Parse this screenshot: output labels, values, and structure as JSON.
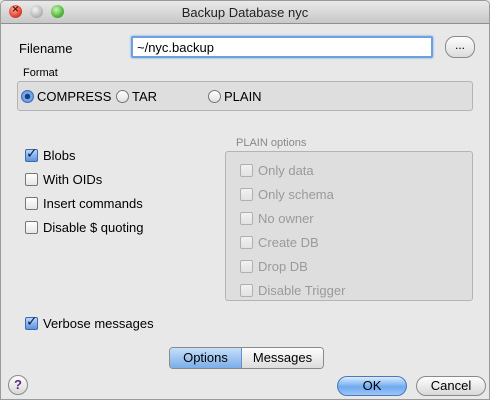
{
  "window": {
    "title": "Backup Database nyc",
    "close_glyph": "×"
  },
  "filename": {
    "label": "Filename",
    "value": "~/nyc.backup",
    "browse_label": "..."
  },
  "format": {
    "caption": "Format",
    "options": [
      {
        "label": "COMPRESS",
        "checked": true
      },
      {
        "label": "TAR",
        "checked": false
      },
      {
        "label": "PLAIN",
        "checked": false
      }
    ]
  },
  "options": {
    "blobs": {
      "label": "Blobs",
      "checked": true
    },
    "with_oids": {
      "label": "With OIDs",
      "checked": false
    },
    "insert_commands": {
      "label": "Insert commands",
      "checked": false
    },
    "disable_quoting": {
      "label": "Disable $ quoting",
      "checked": false
    },
    "verbose": {
      "label": "Verbose messages",
      "checked": true
    }
  },
  "plain_options": {
    "caption": "PLAIN options",
    "items": [
      {
        "label": "Only data",
        "checked": false
      },
      {
        "label": "Only schema",
        "checked": false
      },
      {
        "label": "No owner",
        "checked": false
      },
      {
        "label": "Create DB",
        "checked": false
      },
      {
        "label": "Drop DB",
        "checked": false
      },
      {
        "label": "Disable Trigger",
        "checked": false
      }
    ]
  },
  "tabs": [
    {
      "label": "Options",
      "active": true
    },
    {
      "label": "Messages",
      "active": false
    }
  ],
  "buttons": {
    "help": "?",
    "ok": "OK",
    "cancel": "Cancel"
  },
  "colors": {
    "accent": "#6ea0e0",
    "window_bg": "#e8e8e8",
    "disabled_text": "#9a9a9a"
  }
}
